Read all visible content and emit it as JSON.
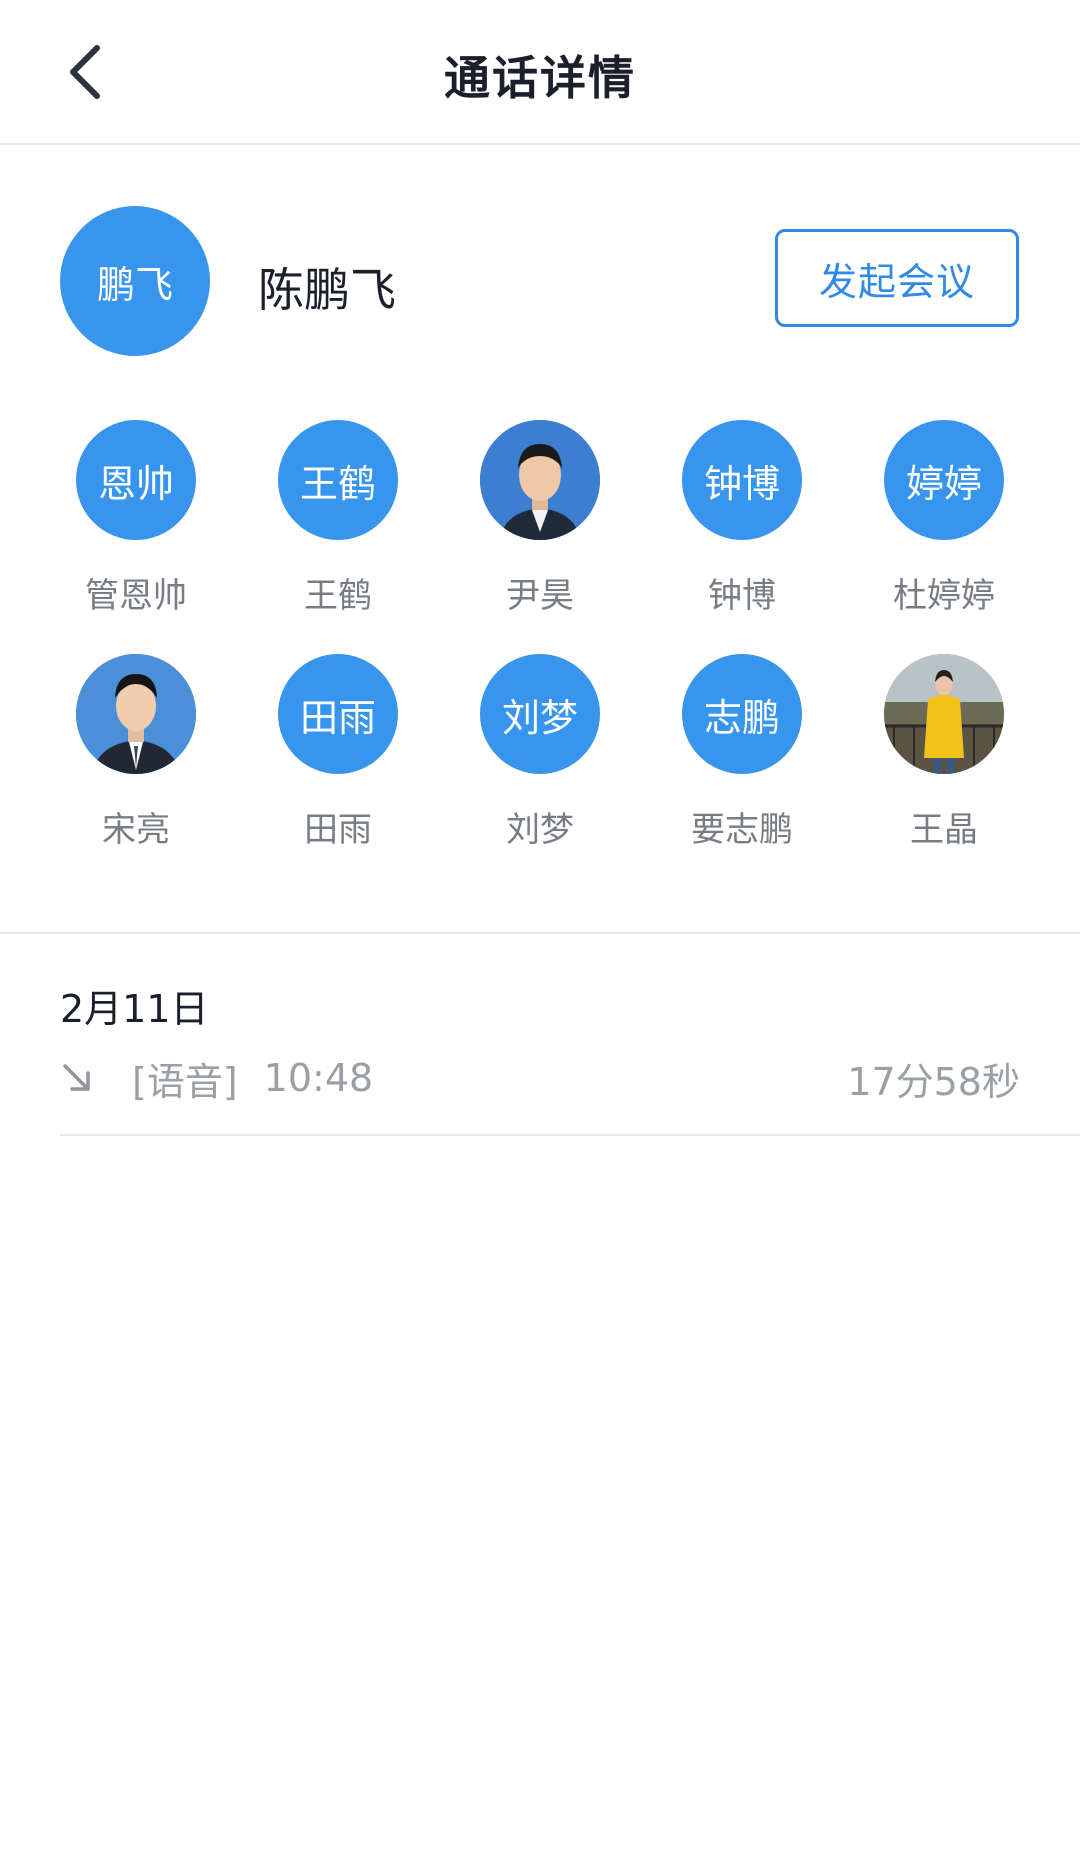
{
  "header": {
    "title": "通话详情",
    "back_icon": "chevron-left-icon"
  },
  "contact": {
    "avatar_text": "鹏飞",
    "name": "陈鹏飞",
    "meeting_button": "发起会议"
  },
  "members": [
    {
      "avatar_text": "恩帅",
      "name": "管恩帅",
      "photo": false
    },
    {
      "avatar_text": "王鹤",
      "name": "王鹤",
      "photo": false
    },
    {
      "avatar_text": "",
      "name": "尹昊",
      "photo": true
    },
    {
      "avatar_text": "钟博",
      "name": "钟博",
      "photo": false
    },
    {
      "avatar_text": "婷婷",
      "name": "杜婷婷",
      "photo": false
    },
    {
      "avatar_text": "",
      "name": "宋亮",
      "photo": true
    },
    {
      "avatar_text": "田雨",
      "name": "田雨",
      "photo": false
    },
    {
      "avatar_text": "刘梦",
      "name": "刘梦",
      "photo": false
    },
    {
      "avatar_text": "志鹏",
      "name": "要志鹏",
      "photo": false
    },
    {
      "avatar_text": "",
      "name": "王晶",
      "photo": true
    }
  ],
  "call_log": {
    "date": "2月11日",
    "type": "[语音]",
    "time": "10:48",
    "duration": "17分58秒",
    "direction_icon": "incoming-arrow-icon"
  },
  "colors": {
    "avatar_blue": "#3795ed",
    "button_blue": "#2f8ae5",
    "text_dark": "#1a1f2b",
    "text_grey": "#9aa0a8"
  }
}
